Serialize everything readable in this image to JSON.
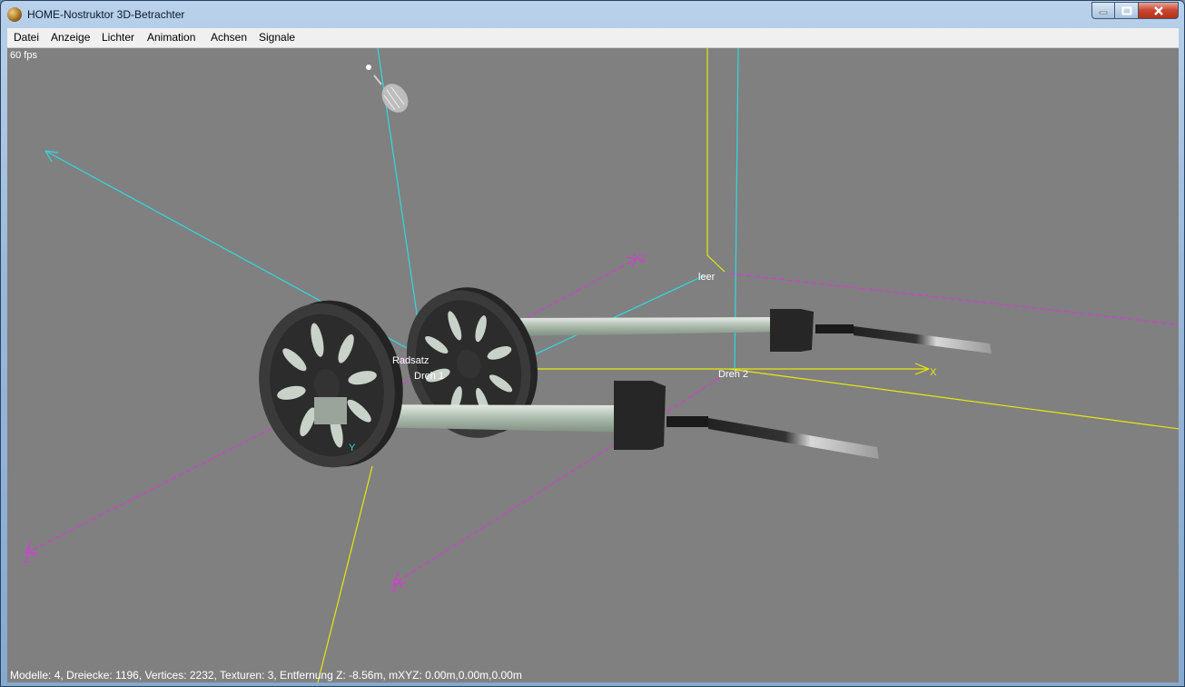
{
  "window": {
    "title": "HOME-Nostruktor 3D-Betrachter"
  },
  "menu": [
    "Datei",
    "Anzeige",
    "Lichter",
    "Animation",
    "Achsen",
    "Signale"
  ],
  "viewport": {
    "fps": "60 fps",
    "labels": {
      "leer": "leer",
      "radsatz": "Radsatz",
      "dreh1": "Dreh 1",
      "dreh2": "Dreh 2"
    },
    "axis_letters": {
      "x": "X",
      "y": "Y",
      "z": "Z"
    },
    "status": "Modelle: 4, Dreiecke: 1196, Vertices: 2232, Texturen: 3, Entfernung Z: -8.56m, mXYZ: 0.00m,0.00m,0.00m"
  },
  "colors": {
    "cyan": "#2fd9e0",
    "yellow": "#e8e80a",
    "magenta": "#d83ad8",
    "background": "#808080"
  },
  "icons": [
    "app-icon",
    "minimize-icon",
    "maximize-icon",
    "close-icon",
    "light-bulb-icon"
  ]
}
